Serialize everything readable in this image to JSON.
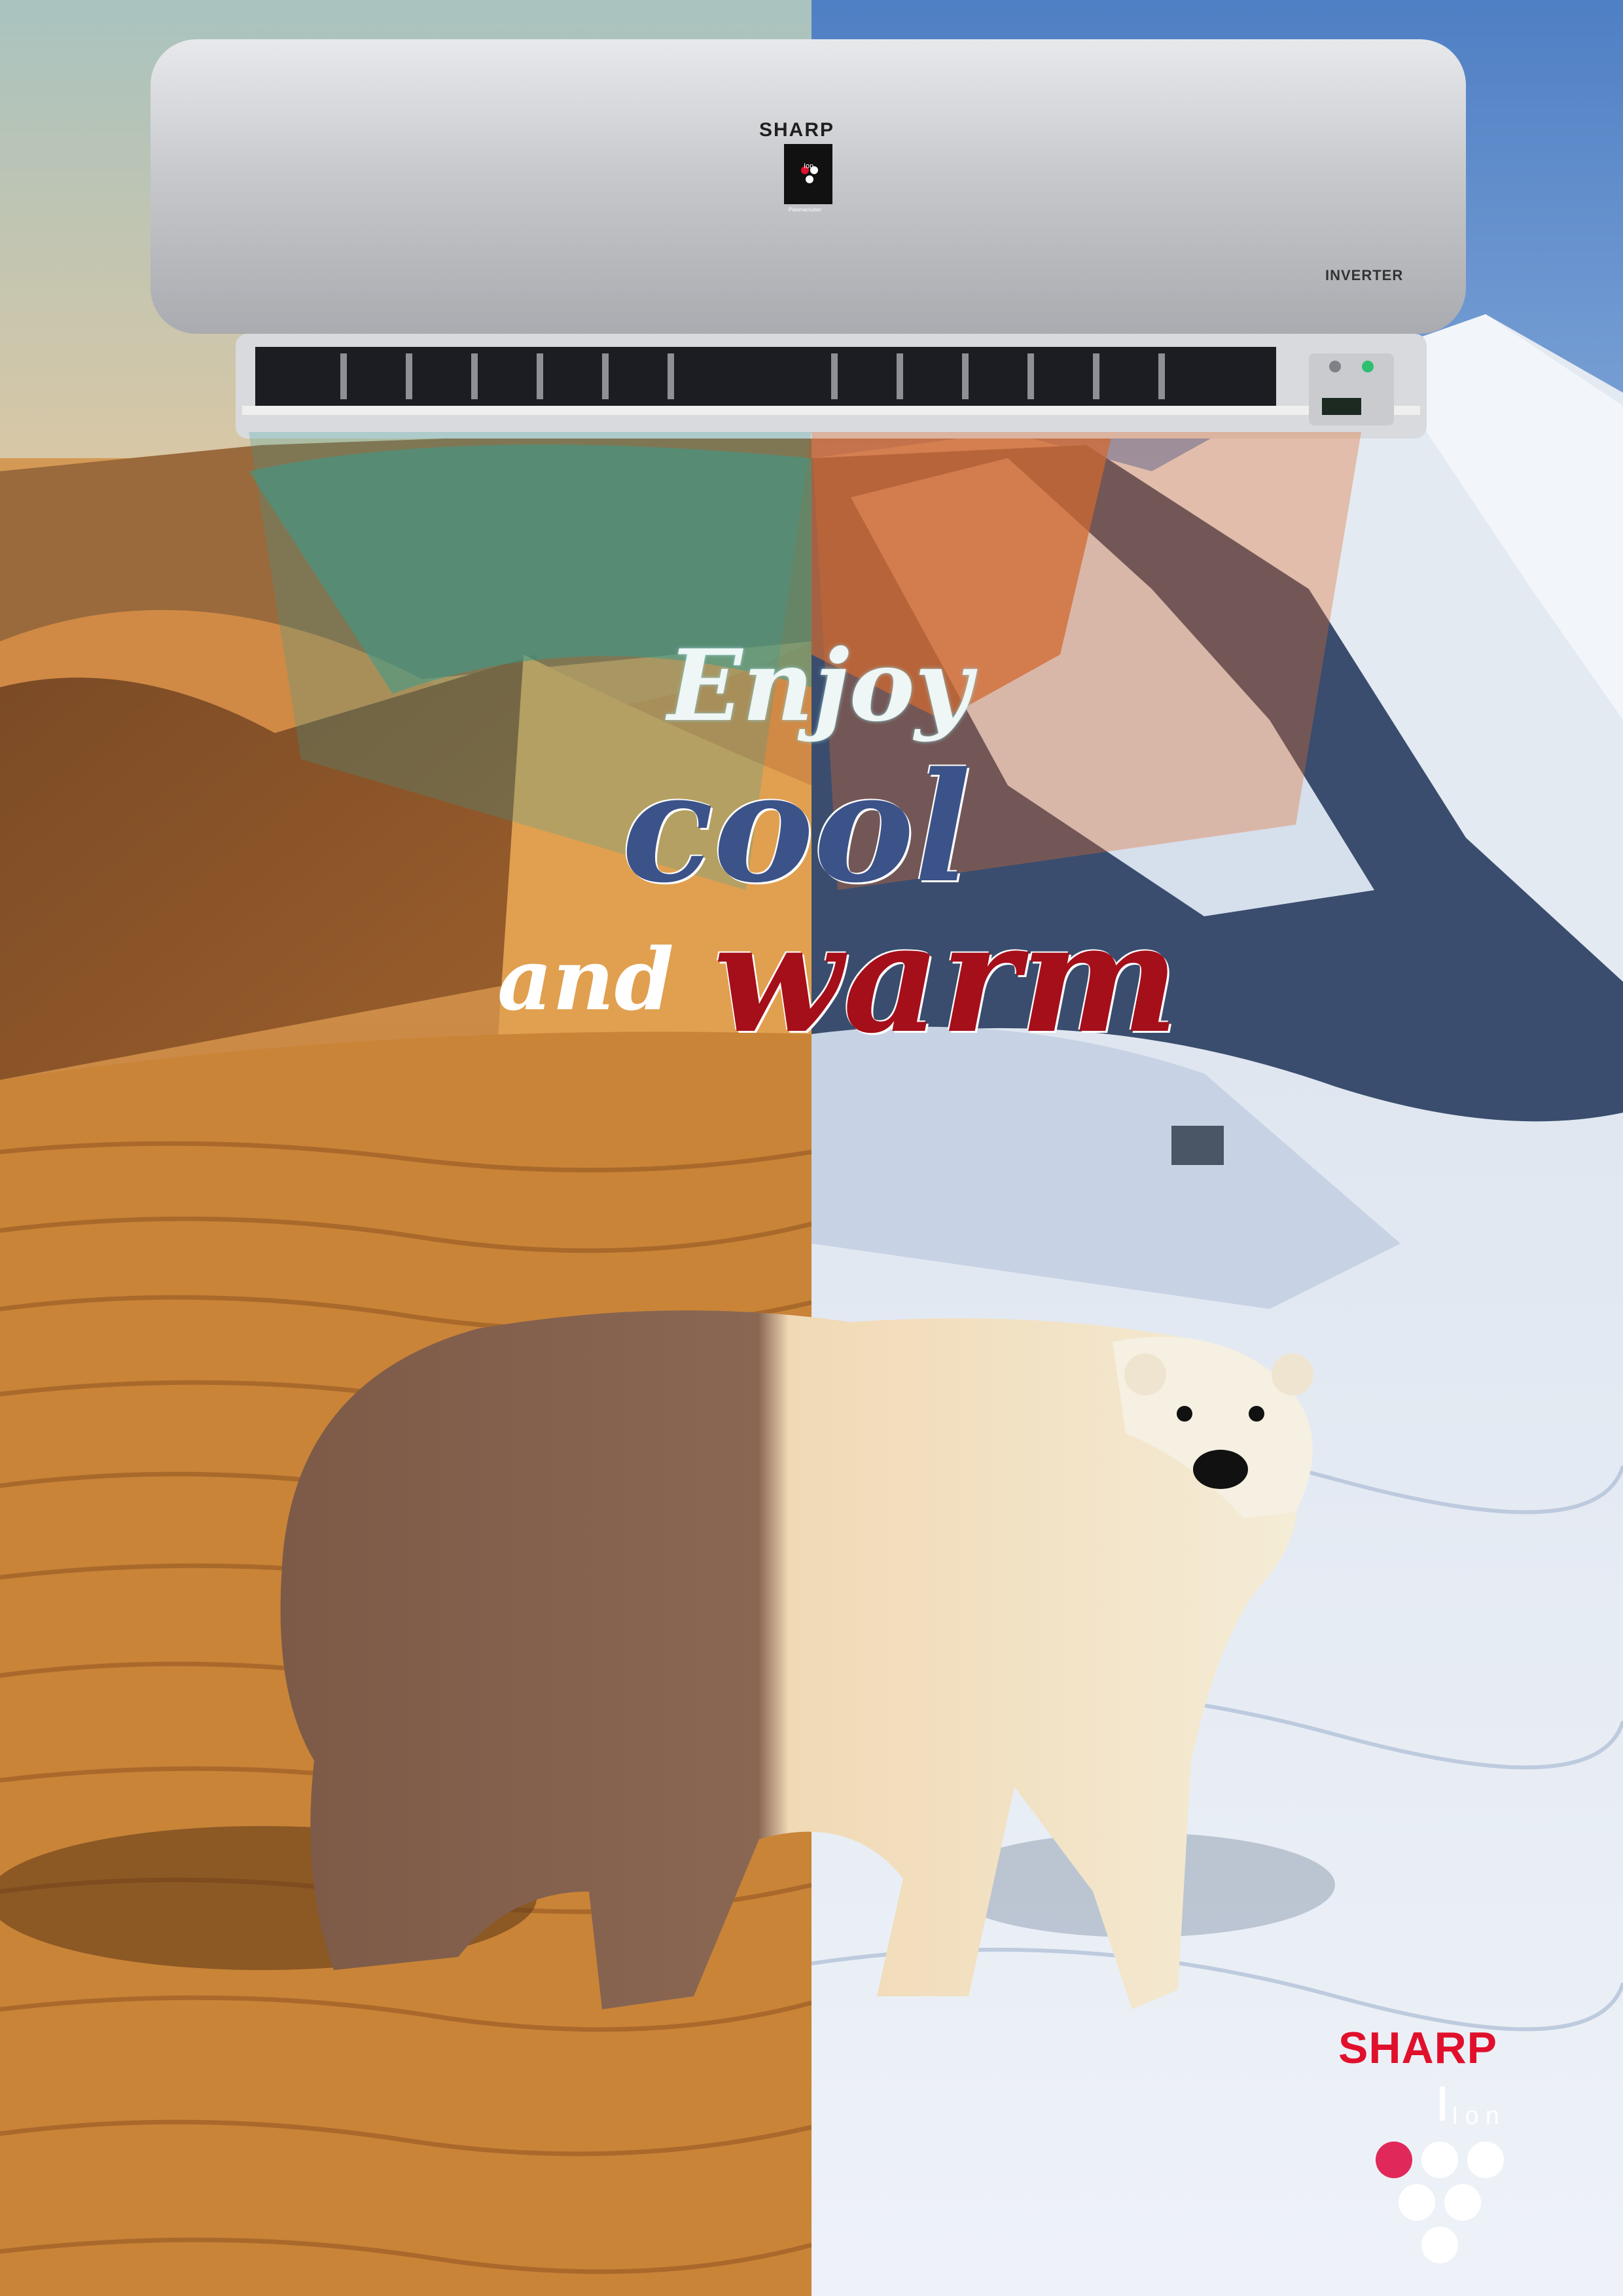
{
  "headline": {
    "line1": "Enjoy",
    "line2": "cool",
    "line3_a": "and",
    "line3_b": "warm"
  },
  "ac_unit": {
    "brand": "SHARP",
    "badge_text": "Ion",
    "badge_caption": "Plasmacluster",
    "model_label": "INVERTER"
  },
  "logo": {
    "brand": "SHARP",
    "ion_text": "Ion"
  },
  "colors": {
    "cool_text": "#3b5388",
    "warm_text": "#a50f1a",
    "brand_red": "#e0102c",
    "desert": "#c9873f",
    "snow": "#e8eef6"
  },
  "icons": [
    "air-conditioner-icon",
    "polar-bear-icon",
    "plasmacluster-ion-icon"
  ]
}
